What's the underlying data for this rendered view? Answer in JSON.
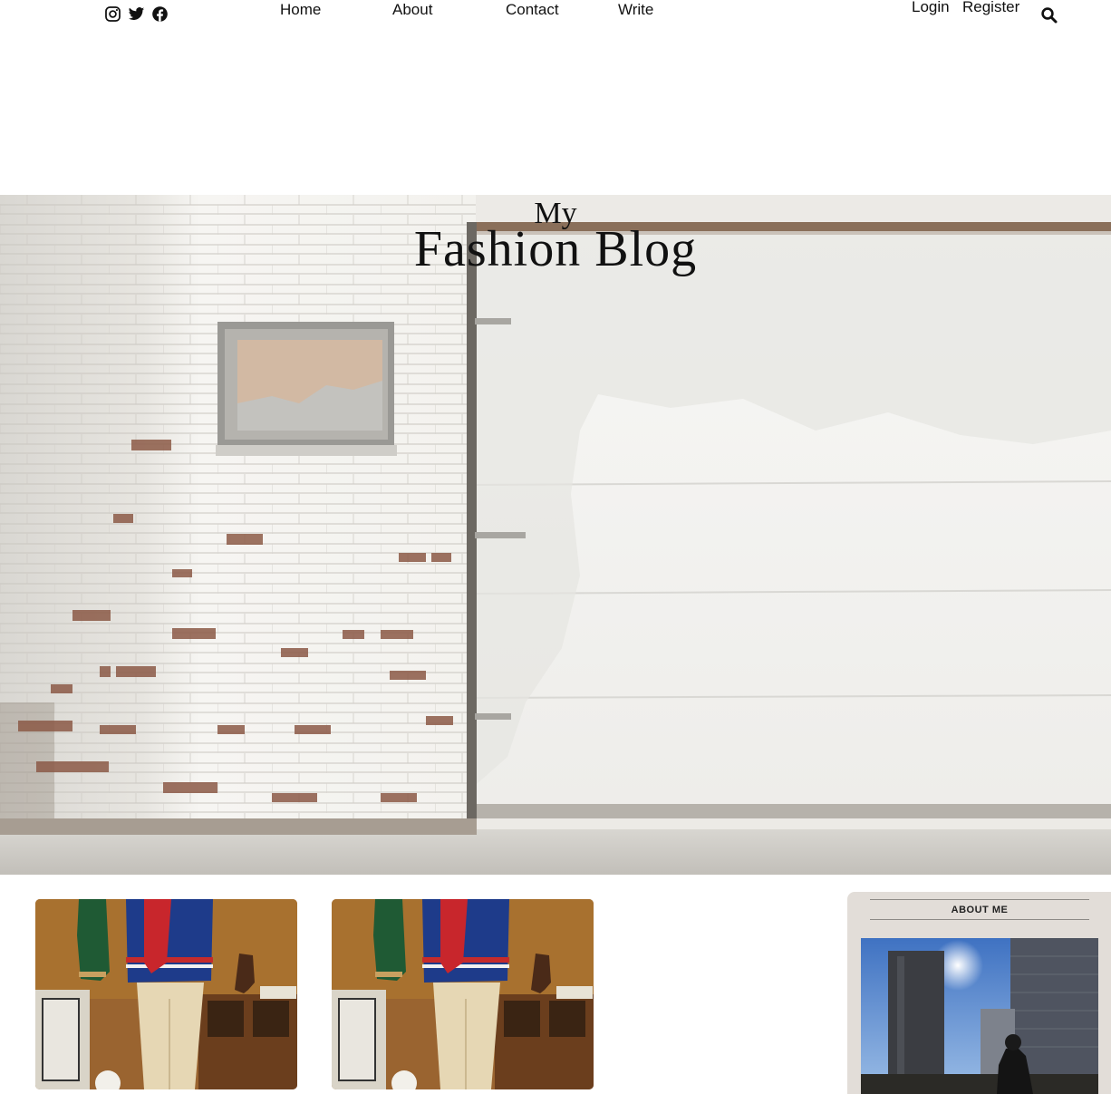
{
  "social": {
    "icons": [
      "instagram-icon",
      "twitter-icon",
      "facebook-icon"
    ]
  },
  "nav": {
    "items": [
      {
        "label": "Home"
      },
      {
        "label": "About"
      },
      {
        "label": "Contact"
      },
      {
        "label": "Write"
      }
    ]
  },
  "auth": {
    "login": "Login",
    "register": "Register"
  },
  "search": {
    "icon": "search-icon"
  },
  "hero": {
    "title_small": "My",
    "title_large": "Fashion Blog"
  },
  "sidebar": {
    "title": "ABOUT ME"
  },
  "colors": {
    "sidebar_bg": "#e2ddd8",
    "text": "#111111"
  }
}
